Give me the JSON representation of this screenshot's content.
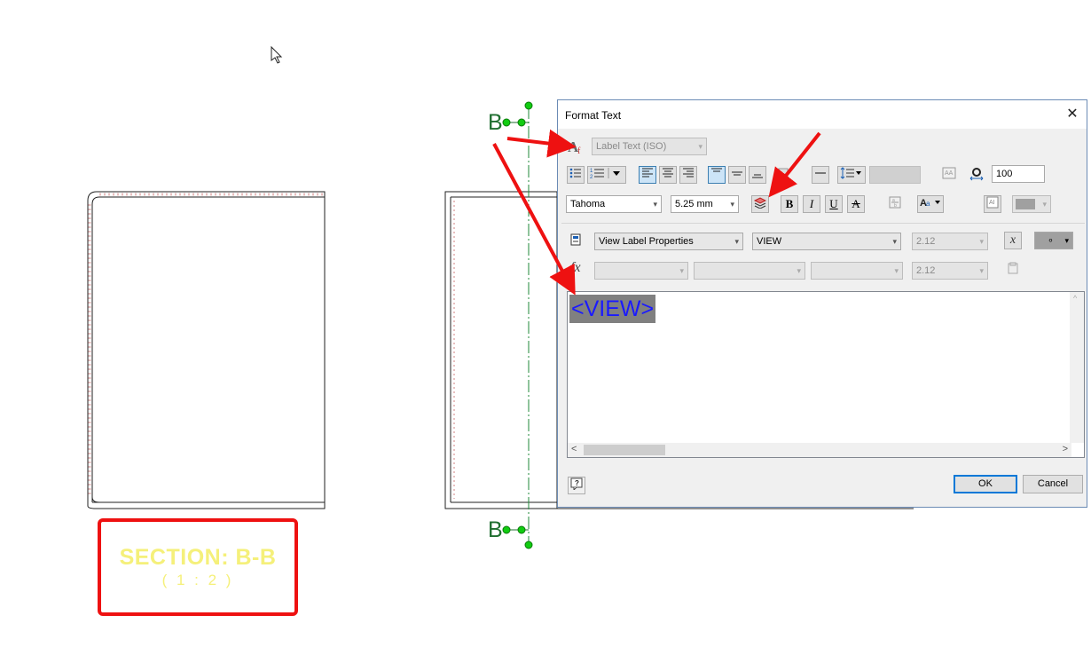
{
  "dialog": {
    "title": "Format Text",
    "close_glyph": "✕",
    "style_combo": "Label Text (ISO)",
    "font_combo": "Tahoma",
    "font_size_combo": "5.25 mm",
    "width_factor": "100",
    "property_type_combo": "View Label Properties",
    "property_combo": "VIEW",
    "precision_combo_1": "2.12",
    "precision_combo_2": "2.12",
    "dot_swatch": "∘",
    "bold_glyph": "B",
    "italic_glyph": "I",
    "underline_glyph": "U",
    "strike_glyph": "A",
    "fx_glyph": "fx",
    "x_glyph": "x",
    "editor_text": "<VIEW>",
    "help_glyph": "?",
    "ok_label": "OK",
    "cancel_label": "Cancel",
    "scroll_left": "<",
    "scroll_right": ">",
    "scroll_up": "^"
  },
  "drawing": {
    "section_title": "SECTION: B-B",
    "section_scale": "( 1 : 2 )",
    "b_top": "B",
    "b_bottom": "B"
  },
  "colors": {
    "annotation_red": "#ee1111",
    "section_yellow": "#f5f07a",
    "marker_green": "#1f6e2f",
    "node_green": "#11cc11",
    "token_blue": "#1a1aff",
    "dialog_border": "#6b8bb5"
  },
  "icons": [
    "mouse-cursor-icon",
    "text-style-icon",
    "bullets-icon",
    "numbering-icon",
    "align-left-icon",
    "align-center-icon",
    "align-right-icon",
    "align-top-icon",
    "align-middle-icon",
    "align-bottom-icon",
    "stack-icon",
    "line-spacing-icon",
    "width-factor-icon",
    "layer-icon",
    "bold-icon",
    "italic-icon",
    "underline-icon",
    "strikethrough-icon",
    "case-icon",
    "symbol-icon",
    "color-swatch-icon",
    "parameter-icon",
    "function-icon",
    "insert-parameter-icon",
    "help-icon"
  ]
}
